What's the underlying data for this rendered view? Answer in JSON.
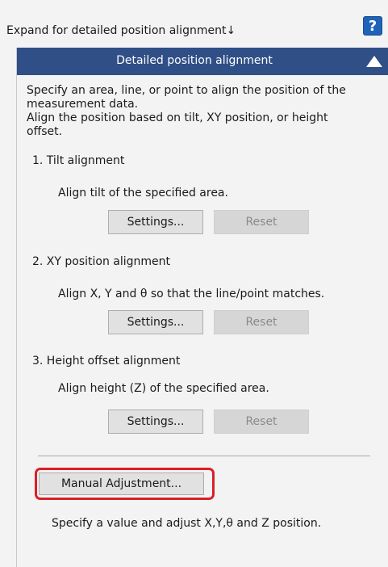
{
  "expand_link": "Expand for detailed position alignment↓",
  "help_icon": "?",
  "colors": {
    "header_bg": "#2f4f86",
    "help_bg": "#1f63b8",
    "highlight": "#d92027"
  },
  "panel": {
    "title": "Detailed position alignment",
    "description_lines": [
      "Specify an area, line, or point to align the position of the",
      "measurement data.",
      "Align the position based on tilt, XY position, or height",
      "offset."
    ],
    "sections": [
      {
        "title": "1. Tilt alignment",
        "description": "Align tilt of the specified area.",
        "settings_label": "Settings...",
        "reset_label": "Reset"
      },
      {
        "title": "2. XY position alignment",
        "description": "Align X, Y and θ so that the line/point matches.",
        "settings_label": "Settings...",
        "reset_label": "Reset"
      },
      {
        "title": "3. Height offset alignment",
        "description": "Align height (Z) of the specified area.",
        "settings_label": "Settings...",
        "reset_label": "Reset"
      }
    ],
    "manual": {
      "button_label": "Manual Adjustment...",
      "description": "Specify a value and adjust X,Y,θ and Z position."
    }
  }
}
